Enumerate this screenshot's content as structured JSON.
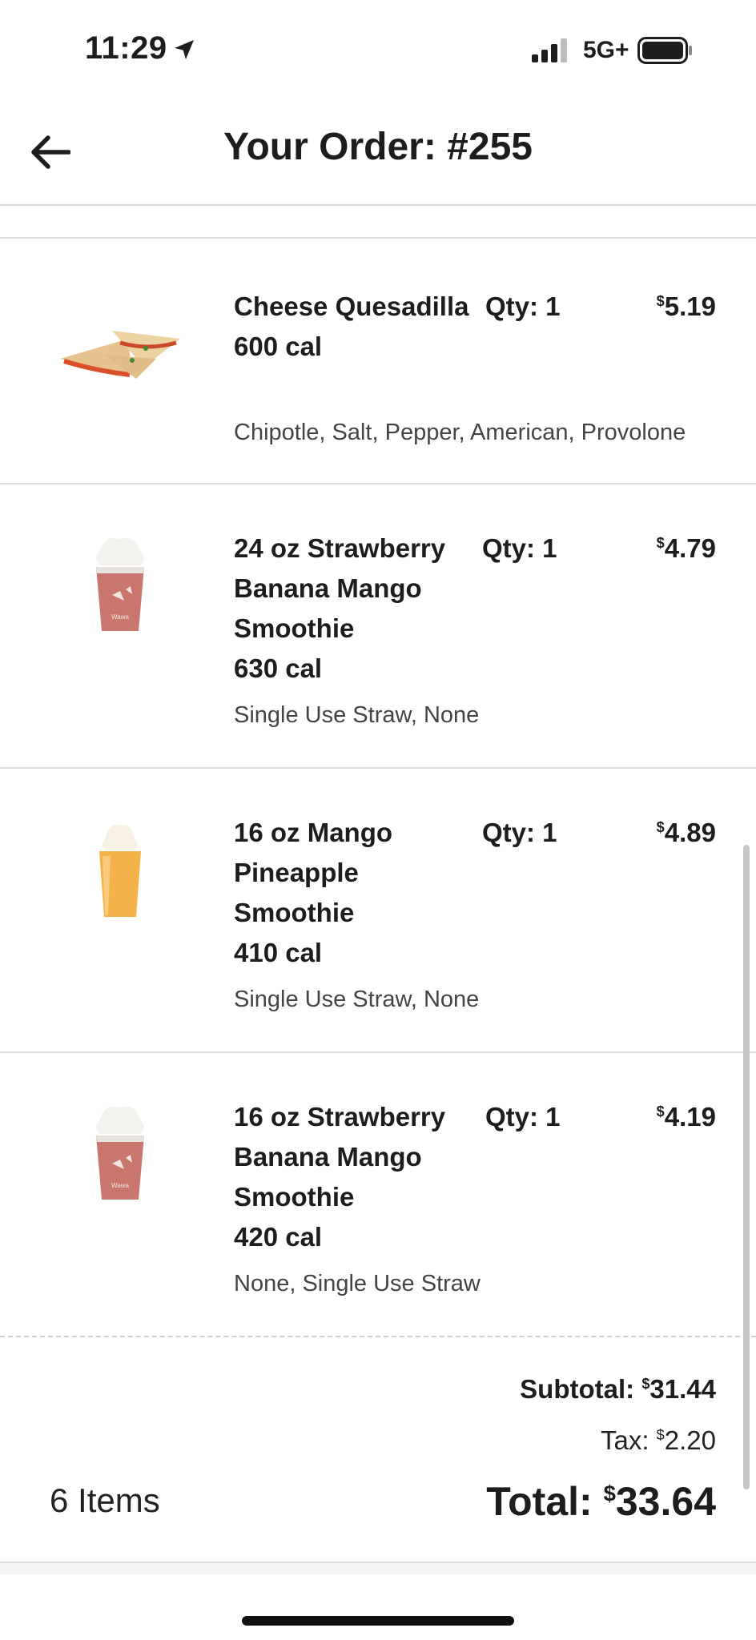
{
  "status_bar": {
    "time": "11:29",
    "network": "5G+"
  },
  "header": {
    "title": "Your Order: #255"
  },
  "items": [
    {
      "name": "Cheese Quesadilla",
      "calories": "600 cal",
      "qty": "Qty: 1",
      "currency": "$",
      "price": "5.19",
      "modifiers": "Chipotle, Salt, Pepper, American, Provolone",
      "image": "quesadilla"
    },
    {
      "name": "24 oz Strawberry Banana Mango Smoothie",
      "calories": "630 cal",
      "qty": "Qty: 1",
      "currency": "$",
      "price": "4.79",
      "modifiers": "Single Use Straw, None",
      "image": "strawberry-smoothie"
    },
    {
      "name": "16 oz Mango Pineapple Smoothie",
      "calories": "410 cal",
      "qty": "Qty: 1",
      "currency": "$",
      "price": "4.89",
      "modifiers": "Single Use Straw, None",
      "image": "mango-smoothie"
    },
    {
      "name": "16 oz Strawberry Banana Mango Smoothie",
      "calories": "420 cal",
      "qty": "Qty: 1",
      "currency": "$",
      "price": "4.19",
      "modifiers": "None, Single Use Straw",
      "image": "strawberry-smoothie"
    }
  ],
  "summary": {
    "subtotal_label": "Subtotal:",
    "subtotal_currency": "$",
    "subtotal": "31.44",
    "tax_label": "Tax:",
    "tax_currency": "$",
    "tax": "2.20",
    "items_count": "6 Items",
    "total_label": "Total:",
    "total_currency": "$",
    "total": "33.64"
  }
}
